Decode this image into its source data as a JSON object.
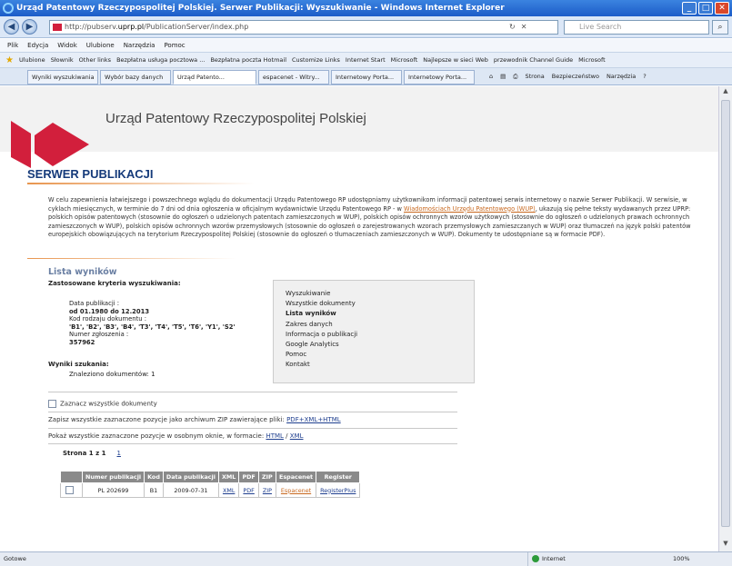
{
  "window": {
    "title": "Urząd Patentowy Rzeczypospolitej Polskiej. Serwer Publikacji: Wyszukiwanie - Windows Internet Explorer",
    "min": "_",
    "max": "□",
    "close": "✕"
  },
  "address": {
    "url_prefix": "http://pubserv.",
    "url_domain": "uprp.pl",
    "url_rest": "/PublicationServer/index.php",
    "search_placeholder": "Live Search"
  },
  "menu": [
    "Plik",
    "Edycja",
    "Widok",
    "Ulubione",
    "Narzędzia",
    "Pomoc"
  ],
  "favorites": [
    "Ulubione",
    "Słownik",
    "Other links",
    "Bezpłatna usługa pocztowa ...",
    "Bezpłatna poczta Hotmail",
    "Customize Links",
    "Internet Start",
    "Microsoft",
    "Najlepsze w sieci Web",
    "przewodnik Channel Guide",
    "Microsoft"
  ],
  "tabs": [
    "Wyniki wyszukiwania",
    "Wybór bazy danych",
    "Urząd Patento...",
    "espacenet - Witry...",
    "Internetowy Porta...",
    "Internetowy Porta..."
  ],
  "tabtools": [
    "Strona",
    "Bezpieczeństwo",
    "Narzędzia"
  ],
  "header": {
    "institution": "Urząd Patentowy Rzeczypospolitej Polskiej",
    "server_title": "SERWER PUBLIKACJI"
  },
  "intro": {
    "text1": "W celu zapewnienia łatwiejszego i powszechnego wglądu do dokumentacji Urzędu Patentowego RP udostępniamy użytkownikom informacji patentowej serwis internetowy o nazwie Serwer Publikacji. W serwisie, w cyklach miesięcznych, w terminie do 7 dni od dnia ogłoszenia w oficjalnym wydawnictwie Urzędu Patentowego RP - w ",
    "link": "Wiadomościach Urzędu Patentowego (WUP)",
    "text2": ", ukazują się pełne teksty wydawanych przez UPRP: polskich opisów patentowych (stosownie do ogłoszeń o udzielonych patentach zamieszczonych w WUP), polskich opisów ochronnych wzorów użytkowych (stosownie do ogłoszeń o udzielonych prawach ochronnych zamieszczonych w WUP), polskich opisów ochronnych wzorów przemysłowych (stosownie do ogłoszeń o zarejestrowanych wzorach przemysłowych zamieszczanych w WUP) oraz tłumaczeń na język polski patentów europejskich obowiązujących na terytorium Rzeczypospolitej Polskiej (stosownie do ogłoszeń o tłumaczeniach zamieszczonych w WUP). Dokumenty te udostępniane są w formacie PDF)."
  },
  "results": {
    "heading": "Lista wyników",
    "criteria_heading": "Zastosowane kryteria wyszukiwania:",
    "date_label": "Data publikacji :",
    "date_value": "od 01.1980 do 12.2013",
    "kind_label": "Kod rodzaju dokumentu :",
    "kind_value": "'B1', 'B2', 'B3', 'B4', 'T3', 'T4', 'T5', 'T6', 'Y1', 'S2'",
    "number_label": "Numer zgłoszenia :",
    "number_value": "357962",
    "summary_heading": "Wyniki szukania:",
    "found": "Znaleziono dokumentów: 1"
  },
  "side_menu": [
    "Wyszukiwanie",
    "Wszystkie dokumenty",
    "Lista wyników",
    "Zakres danych",
    "Informacja o publikacji",
    "Google Analytics",
    "Pomoc",
    "Kontakt"
  ],
  "actions": {
    "select_all": "Zaznacz wszystkie dokumenty",
    "zip_text": "Zapisz wszystkie zaznaczone pozycje jako archiwum ZIP zawierające pliki: ",
    "zip_link": "PDF+XML+HTML",
    "show_text": "Pokaż wszystkie zaznaczone pozycje w osobnym oknie, w formacie: ",
    "show_html": "HTML",
    "show_sep": " / ",
    "show_xml": "XML",
    "page_label": "Strona 1 z 1",
    "page_link": "1"
  },
  "table": {
    "headers": [
      "",
      "Numer publikacji",
      "Kod",
      "Data publikacji",
      "XML",
      "PDF",
      "ZIP",
      "Espacenet",
      "Register"
    ],
    "row": {
      "number": "PL 202699",
      "kod": "B1",
      "date": "2009-07-31",
      "xml": "XML",
      "pdf": "PDF",
      "zip": "ZIP",
      "espacenet": "Espacenet",
      "register": "RegisterPlus"
    }
  },
  "statusbar": {
    "left": "Gotowe",
    "zone": "Internet",
    "zoom": "100%"
  }
}
